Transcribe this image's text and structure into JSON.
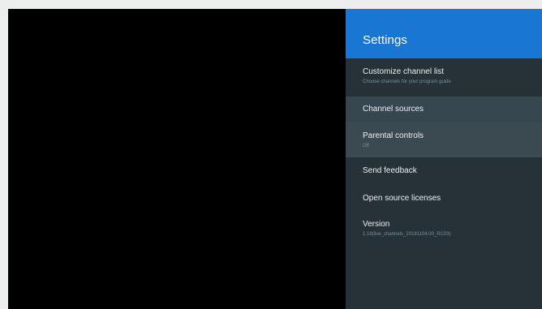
{
  "settings": {
    "title": "Settings",
    "items": [
      {
        "title": "Customize channel list",
        "subtitle": "Choose channels for your program guide"
      },
      {
        "title": "Channel sources",
        "subtitle": ""
      },
      {
        "title": "Parental controls",
        "subtitle": "Off"
      },
      {
        "title": "Send feedback",
        "subtitle": ""
      },
      {
        "title": "Open source licenses",
        "subtitle": ""
      },
      {
        "title": "Version",
        "subtitle": "1.18(live_channels_20181104.00_RC03)"
      }
    ]
  },
  "colors": {
    "header": "#1976d2",
    "panel": "#263238",
    "highlight": "#37474f",
    "background": "#eceeee",
    "screen": "#000000"
  }
}
